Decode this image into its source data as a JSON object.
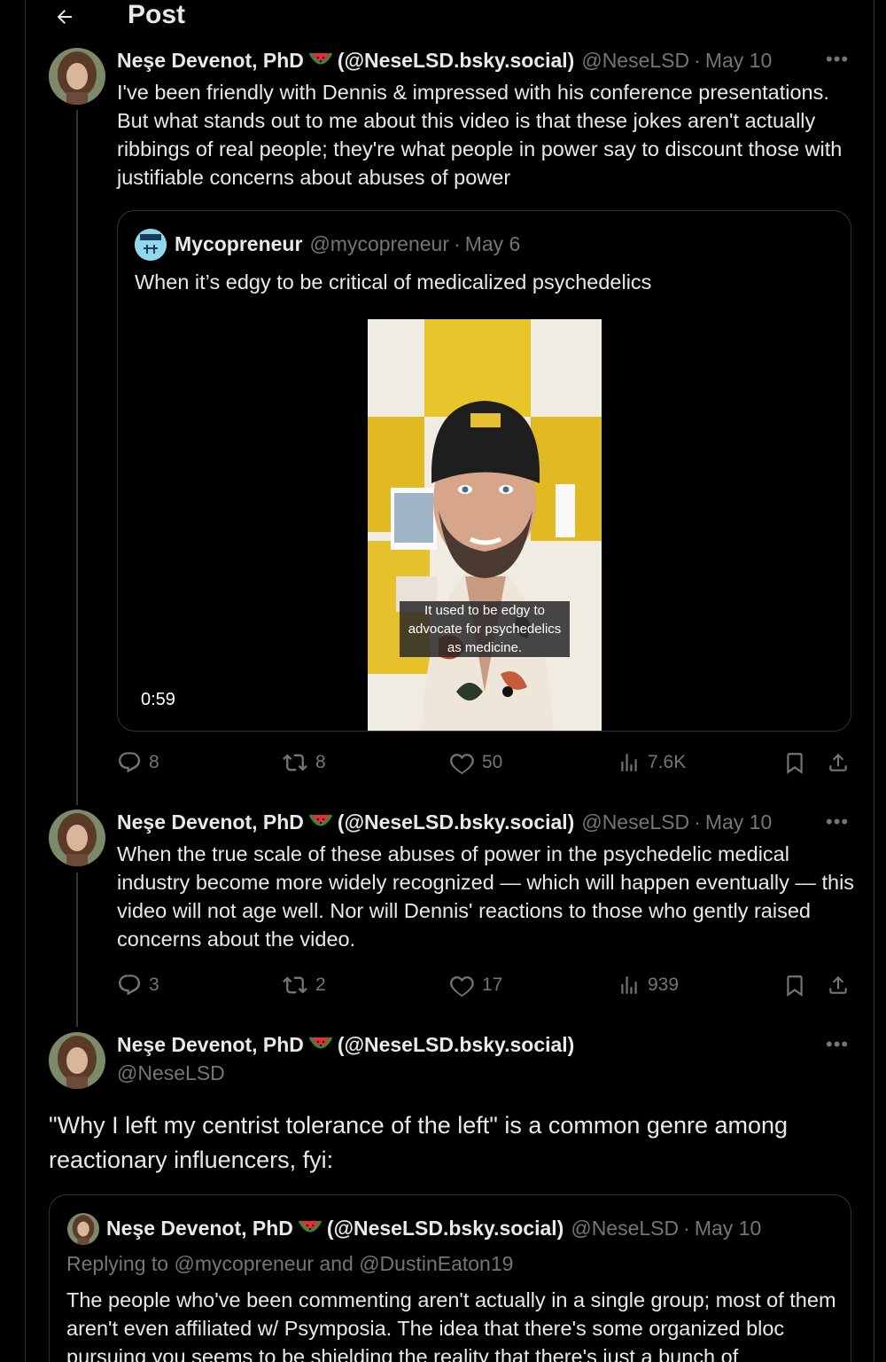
{
  "header": {
    "title": "Post",
    "back_icon": "arrow-left-icon"
  },
  "author": {
    "name": "Neşe Devenot, PhD",
    "bsky": "(@NeseLSD.bsky.social)",
    "handle": "@NeseLSD",
    "emoji": "watermelon-icon"
  },
  "posts": [
    {
      "date": "May 10",
      "text": "I've been friendly with Dennis & impressed with his conference presentations. But what stands out to me about this video is that these jokes aren't actually ribbings of real people; they're what people in power say to discount those with justifiable concerns about abuses of power",
      "quote": {
        "name": "Mycopreneur",
        "handle": "@mycopreneur",
        "date": "May 6",
        "text": "When it’s edgy to be critical of medicalized psychedelics",
        "video": {
          "duration": "0:59",
          "caption": "It used to be edgy to advocate for psychedelics as medicine."
        }
      },
      "stats": {
        "replies": "8",
        "reposts": "8",
        "likes": "50",
        "views": "7.6K"
      }
    },
    {
      "date": "May 10",
      "text": "When the true scale of these abuses of power in the psychedelic medical industry become more widely recognized — which will happen eventually — this video will not age well. Nor will Dennis' reactions to those who gently raised concerns about the video.",
      "stats": {
        "replies": "3",
        "reposts": "2",
        "likes": "17",
        "views": "939"
      }
    },
    {
      "text": "\"Why I left my centrist tolerance of the left\" is a common genre among reactionary influencers, fyi:",
      "quote": {
        "date": "May 10",
        "replying_prefix": "Replying to",
        "replying_to_1": "@mycopreneur",
        "replying_and": "and",
        "replying_to_2": "@DustinEaton19",
        "text": "The people who've been commenting aren't actually in a single group; most of them aren't even affiliated w/ Psymposia. The idea that there's some organized bloc pursuing you seems to be shielding the reality that there's just a bunch of"
      }
    }
  ],
  "colors": {
    "background": "#000000",
    "text": "#e7e9ea",
    "muted": "#71767b",
    "border": "#2f3336",
    "link": "#1d9bf0"
  }
}
